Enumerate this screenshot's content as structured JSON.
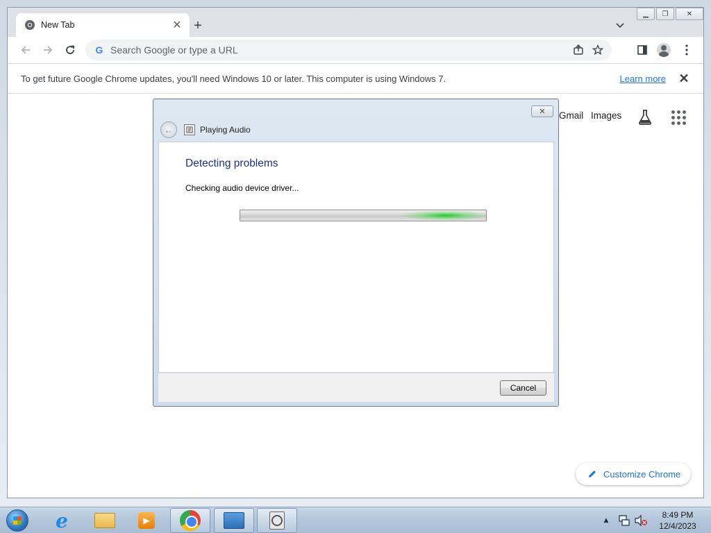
{
  "browser": {
    "tab": {
      "title": "New Tab"
    },
    "omnibox": {
      "placeholder": "Search Google or type a URL"
    },
    "infobar": {
      "message": "To get future Google Chrome updates, you'll need Windows 10 or later. This computer is using Windows 7.",
      "link_label": "Learn more"
    },
    "ntp": {
      "gmail_label": "Gmail",
      "images_label": "Images",
      "customize_label": "Customize Chrome"
    }
  },
  "dialog": {
    "title": "Playing Audio",
    "heading": "Detecting problems",
    "status": "Checking audio device driver...",
    "cancel_label": "Cancel",
    "progress": "indeterminate"
  },
  "taskbar": {
    "items": [
      "internet-explorer",
      "windows-explorer",
      "media-player",
      "google-chrome",
      "control-panel",
      "troubleshooter"
    ],
    "clock": {
      "time": "8:49 PM",
      "date": "12/4/2023"
    }
  },
  "colors": {
    "accent_blue": "#1a73e8",
    "dialog_heading": "#1e3287",
    "progress_glow": "#1ec828"
  }
}
